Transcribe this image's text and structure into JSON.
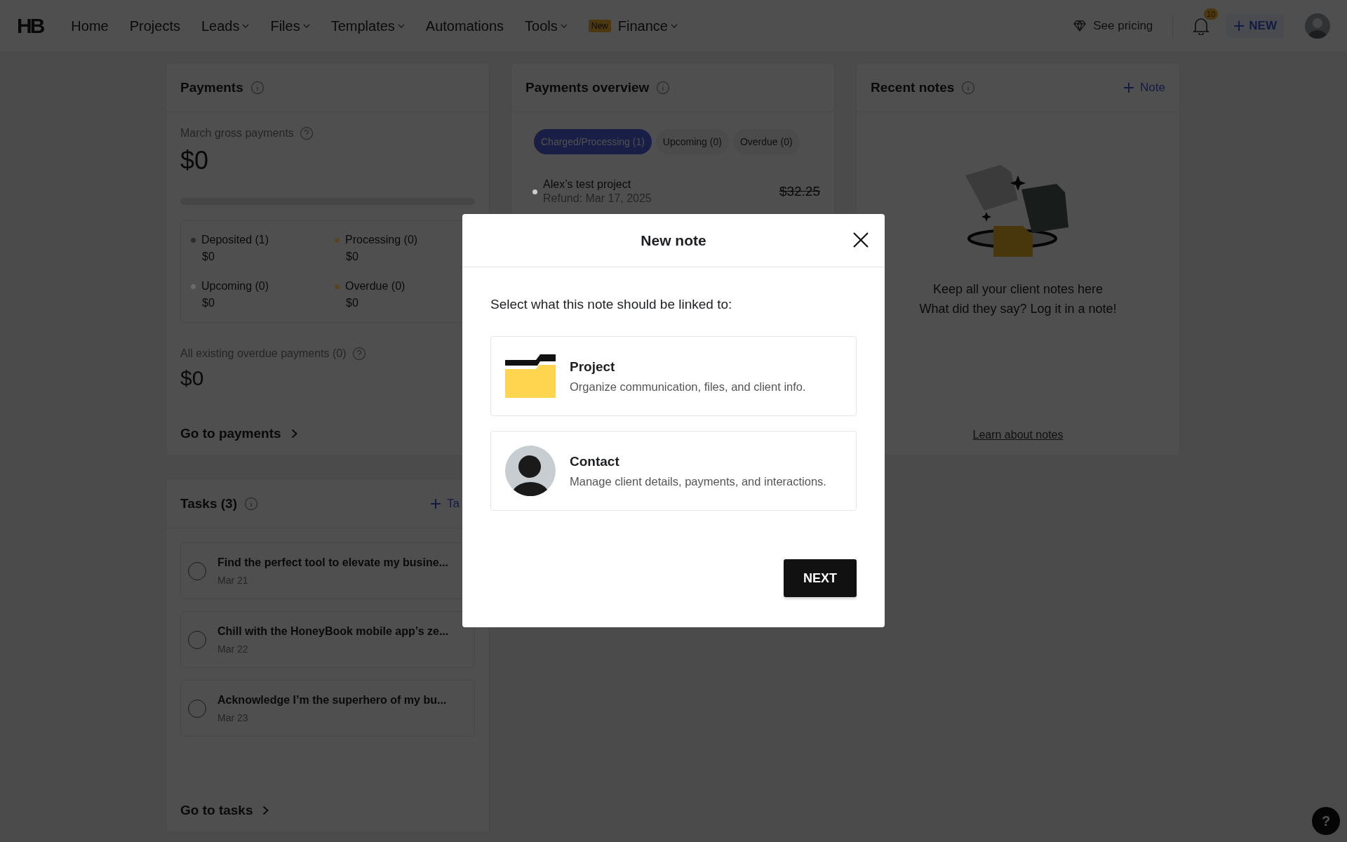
{
  "nav": {
    "logo": "HB",
    "items": [
      {
        "label": "Home",
        "dropdown": false
      },
      {
        "label": "Projects",
        "dropdown": false
      },
      {
        "label": "Leads",
        "dropdown": true
      },
      {
        "label": "Files",
        "dropdown": true
      },
      {
        "label": "Templates",
        "dropdown": true
      },
      {
        "label": "Automations",
        "dropdown": false
      },
      {
        "label": "Tools",
        "dropdown": true
      },
      {
        "label": "Finance",
        "dropdown": true,
        "badge": "New"
      }
    ],
    "pricing": "See pricing",
    "notifications": "10",
    "new_button": "NEW"
  },
  "payments": {
    "title": "Payments",
    "gross_label": "March gross payments",
    "gross_value": "$0",
    "summary": [
      {
        "label": "Deposited (1)",
        "value": "$0",
        "color": "#2a2c2e"
      },
      {
        "label": "Processing (0)",
        "value": "$0",
        "color": "#5a4520"
      },
      {
        "label": "Upcoming (0)",
        "value": "$0",
        "color": "#6a6a6a"
      },
      {
        "label": "Overdue (0)",
        "value": "$0",
        "color": "#5a4420"
      }
    ],
    "overdue_label": "All existing overdue payments (0)",
    "overdue_value": "$0",
    "link": "Go to payments"
  },
  "overview": {
    "title": "Payments overview",
    "tabs": [
      {
        "label": "Charged/Processing (1)",
        "selected": true
      },
      {
        "label": "Upcoming (0)",
        "selected": false
      },
      {
        "label": "Overdue (0)",
        "selected": false
      }
    ],
    "rows": [
      {
        "name": "Alex’s test project",
        "detail": "Refund: Mar 17, 2025",
        "amount": "$32.25"
      }
    ]
  },
  "notes": {
    "title": "Recent notes",
    "add": "Note",
    "empty_lines": [
      "Keep all your client notes here",
      "What did they say? Log it in a note!"
    ],
    "link": "Learn about notes"
  },
  "tasks": {
    "title": "Tasks (3)",
    "add": "Ta",
    "items": [
      {
        "title": "Find the perfect tool to elevate my busine...",
        "date": "Mar 21",
        "checked": false
      },
      {
        "title": "Chill with the HoneyBook mobile app’s ze...",
        "date": "Mar 22",
        "checked": false
      },
      {
        "title": "Acknowledge I’m the superhero of my bu...",
        "date": "Mar 23",
        "checked": false
      }
    ],
    "link": "Go to tasks"
  },
  "help": "?",
  "modal": {
    "title": "New note",
    "prompt": "Select what this note should be linked to:",
    "options": [
      {
        "kind": "project",
        "title": "Project",
        "description": "Organize communication, files, and client info."
      },
      {
        "kind": "contact",
        "title": "Contact",
        "description": "Manage client details, payments, and interactions."
      }
    ],
    "next": "NEXT"
  }
}
